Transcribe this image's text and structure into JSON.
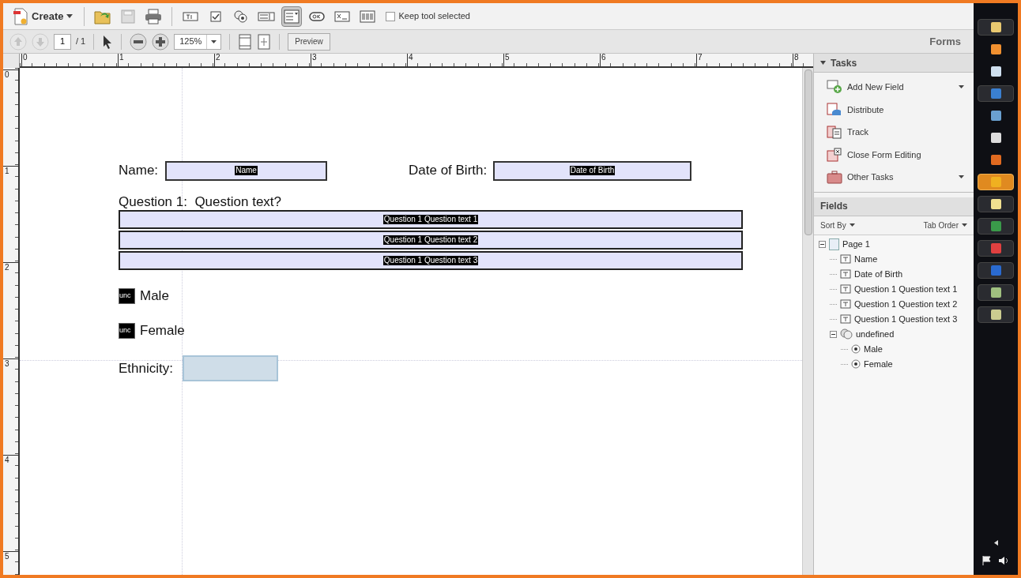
{
  "toolbar": {
    "create": "Create",
    "tools": [
      {
        "kind": "open",
        "selected": false
      },
      {
        "kind": "save",
        "selected": false
      },
      {
        "kind": "print",
        "selected": false
      },
      {
        "kind": "text-field",
        "selected": false
      },
      {
        "kind": "checkbox",
        "selected": false
      },
      {
        "kind": "radio",
        "selected": false
      },
      {
        "kind": "list-box",
        "selected": false
      },
      {
        "kind": "dropdown",
        "selected": true
      },
      {
        "kind": "button",
        "selected": false
      },
      {
        "kind": "signature",
        "selected": false
      },
      {
        "kind": "barcode",
        "selected": false
      }
    ],
    "keep_tool": {
      "label": "Keep tool selected",
      "checked": false
    }
  },
  "nav": {
    "page": "1",
    "of": "/ 1",
    "zoom": "125%",
    "preview": "Preview",
    "mode": "Forms"
  },
  "ruler": {
    "horizontal": [
      "0",
      "1",
      "2",
      "3",
      "4",
      "5",
      "6",
      "7",
      "8"
    ],
    "vertical": [
      "0",
      "1",
      "2",
      "3",
      "4",
      "5"
    ]
  },
  "form": {
    "name_label": "Name:",
    "name_field": "Name",
    "dob_label": "Date of Birth:",
    "dob_field": "Date of Birth",
    "question": "Question 1:  Question text?",
    "answers": [
      "Question 1 Question text 1",
      "Question 1 Question text 2",
      "Question 1 Question text 3"
    ],
    "radios": [
      {
        "tag": "unc",
        "label": "Male"
      },
      {
        "tag": "unc",
        "label": "Female"
      }
    ],
    "ethnicity_label": "Ethnicity:",
    "ethnicity_selected": true
  },
  "tasks": {
    "title": "Tasks",
    "expanded": true,
    "items": [
      {
        "kind": "add",
        "label": "Add New Field",
        "menu": true
      },
      {
        "kind": "distribute",
        "label": "Distribute",
        "menu": false
      },
      {
        "kind": "track",
        "label": "Track",
        "menu": false
      },
      {
        "kind": "close",
        "label": "Close Form Editing",
        "menu": false
      },
      {
        "kind": "other",
        "label": "Other Tasks",
        "menu": true
      }
    ]
  },
  "fields": {
    "title": "Fields",
    "sort": "Sort By",
    "order": "Tab Order",
    "tree": [
      {
        "kind": "page",
        "label": "Page 1",
        "expanded": true,
        "children": [
          {
            "kind": "text",
            "label": "Name"
          },
          {
            "kind": "text",
            "label": "Date of Birth"
          },
          {
            "kind": "text",
            "label": "Question 1 Question text 1"
          },
          {
            "kind": "text",
            "label": "Question 1 Question text 2"
          },
          {
            "kind": "text",
            "label": "Question 1 Question text 3"
          },
          {
            "kind": "group",
            "label": "undefined",
            "expanded": true,
            "children": [
              {
                "kind": "radio",
                "label": "Male"
              },
              {
                "kind": "radio",
                "label": "Female"
              }
            ]
          }
        ]
      }
    ]
  },
  "taskbar": [
    {
      "kind": "explorer",
      "selected": false
    },
    {
      "kind": "media",
      "selected": false
    },
    {
      "kind": "notes",
      "selected": false
    },
    {
      "kind": "ie",
      "selected": false
    },
    {
      "kind": "window",
      "selected": false
    },
    {
      "kind": "app",
      "selected": false
    },
    {
      "kind": "firefox",
      "selected": false
    },
    {
      "kind": "outlook",
      "selected": true
    },
    {
      "kind": "sticky",
      "selected": false
    },
    {
      "kind": "excel",
      "selected": false
    },
    {
      "kind": "pdf",
      "selected": false
    },
    {
      "kind": "word",
      "selected": false
    },
    {
      "kind": "image",
      "selected": false
    },
    {
      "kind": "tool",
      "selected": false
    }
  ]
}
